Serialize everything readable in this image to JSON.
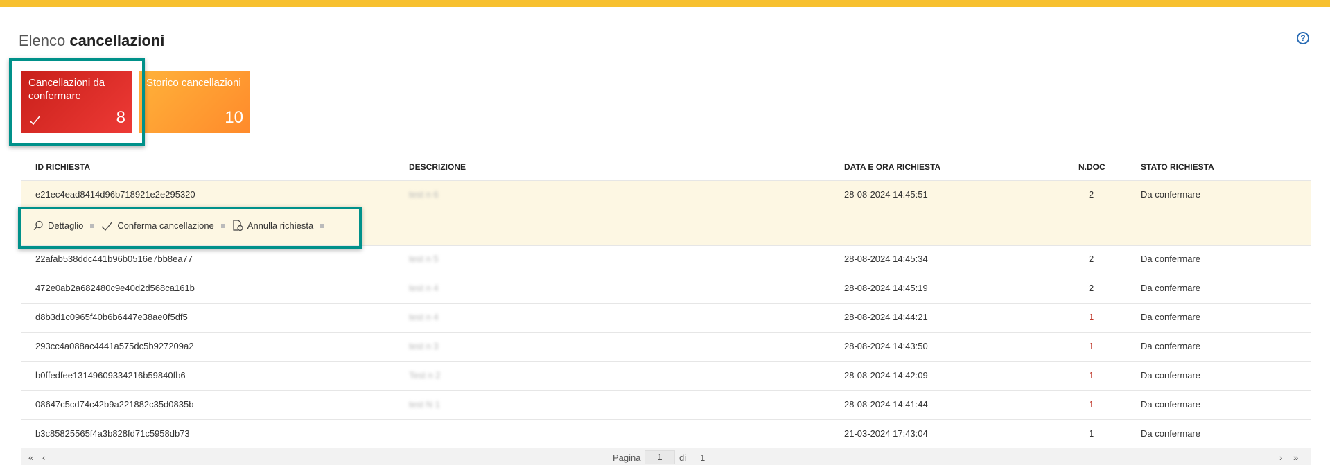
{
  "header": {
    "title_light": "Elenco",
    "title_bold": "cancellazioni",
    "help_label": "?"
  },
  "tiles": [
    {
      "label": "Cancellazioni da confermare",
      "count": "8"
    },
    {
      "label": "Storico cancellazioni",
      "count": "10"
    }
  ],
  "table": {
    "columns": [
      "ID RICHIESTA",
      "DESCRIZIONE",
      "DATA E ORA RICHIESTA",
      "N.DOC",
      "STATO RICHIESTA"
    ],
    "rows": [
      {
        "id": "e21ec4ead8414d96b718921e2e295320",
        "desc": "test n 6",
        "date": "28-08-2024 14:45:51",
        "ndoc": "2",
        "stato": "Da confermare"
      },
      {
        "id": "22afab538ddc441b96b0516e7bb8ea77",
        "desc": "test n 5",
        "date": "28-08-2024 14:45:34",
        "ndoc": "2",
        "stato": "Da confermare"
      },
      {
        "id": "472e0ab2a682480c9e40d2d568ca161b",
        "desc": "test n 4",
        "date": "28-08-2024 14:45:19",
        "ndoc": "2",
        "stato": "Da confermare"
      },
      {
        "id": "d8b3d1c0965f40b6b6447e38ae0f5df5",
        "desc": "test n 4",
        "date": "28-08-2024 14:44:21",
        "ndoc": "1",
        "stato": "Da confermare"
      },
      {
        "id": "293cc4a088ac4441a575dc5b927209a2",
        "desc": "test n 3",
        "date": "28-08-2024 14:43:50",
        "ndoc": "1",
        "stato": "Da confermare"
      },
      {
        "id": "b0ffedfee13149609334216b59840fb6",
        "desc": "Test n 2",
        "date": "28-08-2024 14:42:09",
        "ndoc": "1",
        "stato": "Da confermare"
      },
      {
        "id": "08647c5cd74c42b9a221882c35d0835b",
        "desc": "test N 1",
        "date": "28-08-2024 14:41:44",
        "ndoc": "1",
        "stato": "Da confermare"
      },
      {
        "id": "b3c85825565f4a3b828fd71c5958db73",
        "desc": "",
        "date": "21-03-2024 17:43:04",
        "ndoc": "1",
        "stato": "Da confermare"
      }
    ],
    "actions": {
      "detail": "Dettaglio",
      "confirm": "Conferma cancellazione",
      "cancel": "Annulla richiesta"
    }
  },
  "pager": {
    "label_page": "Pagina",
    "current": "1",
    "label_of": "di",
    "total": "1"
  },
  "colors": {
    "accent_bar": "#f7c02f",
    "highlight": "#00918a",
    "tile_red": "#d42a24",
    "tile_orange": "#ff9f33"
  }
}
